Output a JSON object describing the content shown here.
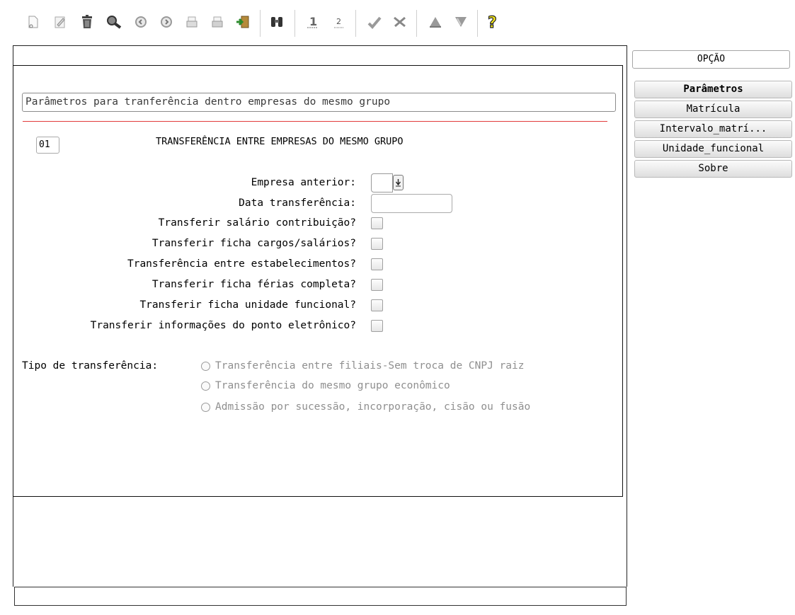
{
  "toolbar": {
    "buttons": [
      {
        "name": "new-icon",
        "label": "Novo"
      },
      {
        "name": "edit-icon",
        "label": "Editar"
      },
      {
        "name": "trash-icon",
        "label": "Eliminar"
      },
      {
        "name": "search-icon",
        "label": "Pesquisar"
      },
      {
        "name": "prev-icon",
        "label": "Anterior"
      },
      {
        "name": "next-icon",
        "label": "Próximo"
      },
      {
        "name": "print-icon",
        "label": "Imprimir"
      },
      {
        "name": "print-setup-icon",
        "label": "Configurar"
      },
      {
        "name": "exit-icon",
        "label": "Sair"
      },
      {
        "name": "binoculars-icon",
        "label": "Localizar"
      },
      {
        "name": "digit-one-icon",
        "label": "1"
      },
      {
        "name": "digit-two-icon",
        "label": "2"
      },
      {
        "name": "check-icon",
        "label": "OK"
      },
      {
        "name": "tools-icon",
        "label": "Ferramentas"
      },
      {
        "name": "triangle-up-icon",
        "label": "Sobe"
      },
      {
        "name": "filter-icon",
        "label": "Filtro"
      },
      {
        "name": "help-icon",
        "label": "?"
      }
    ]
  },
  "form": {
    "title": "Parâmetros para tranferência dentro empresas do mesmo grupo",
    "section_code": "01",
    "section_title": "TRANSFERÊNCIA ENTRE EMPRESAS DO MESMO GRUPO",
    "empresa_label": "Empresa anterior:",
    "data_label": "Data transferência:",
    "checks": [
      "Transferir salário contribuição?",
      "Transferir ficha cargos/salários?",
      "Transferência entre estabelecimentos?",
      "Transferir ficha férias completa?",
      "Transferir ficha unidade funcional?",
      "Transferir informações do ponto eletrônico?"
    ],
    "tipo_label": "Tipo de transferência:",
    "radios": [
      "Transferência entre filiais-Sem troca de CNPJ raiz",
      "Transferência do mesmo grupo econômico",
      "Admissão por sucessão, incorporação, cisão ou fusão"
    ]
  },
  "side": {
    "header": "OPÇÃO",
    "buttons": [
      "Parâmetros",
      "Matrícula",
      "Intervalo_matrí...",
      "Unidade_funcional",
      "Sobre"
    ]
  }
}
